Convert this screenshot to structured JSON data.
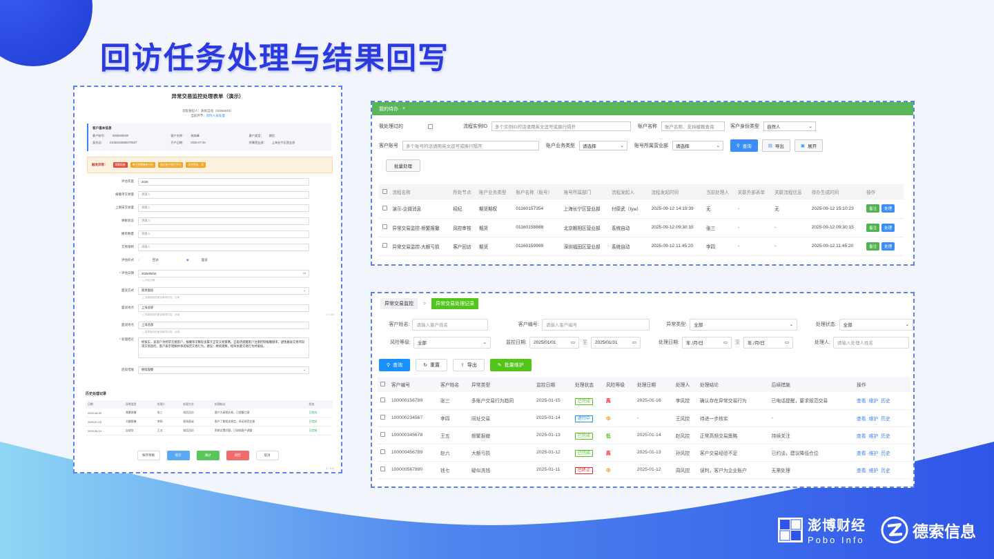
{
  "slide": {
    "title": "回访任务处理与结果回写",
    "colors": {
      "title": "#2a3ae0",
      "accent_blue": "#3b82f6",
      "green": "#52c41a",
      "wave": "#2f55e8"
    }
  },
  "form_panel": {
    "title": "异常交易监控处理表单（演示）",
    "meta_line1": "流程发起人：系统自动（20250915）",
    "meta_line2_prefix": "当前环节：",
    "meta_line2_link": "风险人员处理",
    "info_title": "客户基本信息",
    "info": [
      {
        "label": "客户账号：",
        "value": "0000000000"
      },
      {
        "label": "客户名称：",
        "value": "林奕峰"
      },
      {
        "label": "客户类型：",
        "value": "期货"
      },
      {
        "label": "身份证：",
        "value": "21060319550070527"
      },
      {
        "label": "开户日期：",
        "value": "2025-07-26"
      },
      {
        "label": "所属营业部：",
        "value": "上海长宁区营业部"
      }
    ],
    "alert_label": "触发异常：",
    "alert_tags": [
      {
        "text": "频繁报撤",
        "color": "#e84b3c"
      },
      {
        "text": "单日频繁撤单分析",
        "color": "#f5a623"
      },
      {
        "text": "指定账户隔日平仓",
        "color": "#f5a623"
      },
      {
        "text": "风险等级：高",
        "color": "#f5a623"
      }
    ],
    "fields": [
      {
        "label": "评估年度",
        "value": "2025",
        "filled": true
      },
      {
        "label": "报撤单交易量",
        "value": "请输入",
        "filled": false
      },
      {
        "label": "上期末交易量",
        "value": "请输入",
        "filled": false
      },
      {
        "label": "休眠状态",
        "value": "请输入",
        "filled": false
      },
      {
        "label": "撤单数量",
        "value": "请输入",
        "filled": false
      },
      {
        "label": "交易限制",
        "value": "请输入",
        "filled": false
      }
    ],
    "eval_method_label": "评估形式",
    "eval_methods": [
      "回访",
      "面谈"
    ],
    "eval_date_label": "* 评估日期",
    "eval_date": "2025/09/15",
    "eval_date_hint": "△ 评估日期",
    "interview_method_label": "面谈方式",
    "interview_method": "现场面谈",
    "interview_hint": "△ 选择面谈的面谈事项内容，必填",
    "interview_place_label": "面谈地点",
    "interview_place": "上海总部",
    "interview_place_hint": "△ 选择面谈的面谈事项内容，必填",
    "interview_place2_label": "面谈地点",
    "interview_place2": "上海总部",
    "interview_place2_hint": "△ 选择面谈的面谈事项内容，必填",
    "conclusion_label": "* 处理结论",
    "conclusion": "经核实，该客户为经常无规客户，报撤单次数较多属于正常交易策略。已电话提醒客户注意控制报撤频率，避免触发交易所异常交易监控。客户表示理解并承诺规范交易行为。建议：继续观察，指导关键交易行为并复核。",
    "result_label": "后续措施",
    "result_value": "继续观察",
    "page_no_1": "4 / 100",
    "page_no_2": "4 / 100",
    "history_title": "历史处理记录",
    "history_headers": [
      "日期",
      "异常类型",
      "处理人",
      "处理方式",
      "处理结论",
      "状态"
    ],
    "history_rows": [
      [
        "2025-06-20",
        "频繁报撤",
        "张三",
        "电话回访",
        "客户为高频交易，已提醒注意",
        "已完成"
      ],
      [
        "2025-07-15",
        "大额报撤",
        "李四",
        "现场面谈",
        "客户了解相关规定，承诺规范交易",
        "已完成"
      ],
      [
        "2025-06-10",
        "自成交",
        "王五",
        "电话回访",
        "系统设置问题，已协助客户调整",
        "已完成"
      ]
    ],
    "buttons": [
      {
        "text": "保存草稿",
        "bg": "#ffffff",
        "fg": "#555555"
      },
      {
        "text": "提交",
        "bg": "#5ba8f5",
        "fg": "#ffffff"
      },
      {
        "text": "通过",
        "bg": "#5cc45c",
        "fg": "#ffffff"
      },
      {
        "text": "驳回",
        "bg": "#f26b6b",
        "fg": "#ffffff"
      },
      {
        "text": "取消",
        "bg": "#ffffff",
        "fg": "#555555"
      }
    ]
  },
  "todo_panel": {
    "header": "我的待办",
    "header_close": "×",
    "q_processed": "我处理过的",
    "q_instance_label": "流程实例ID",
    "q_instance_ph": "多个实例ID的话请用英文逗号或换行隔开",
    "q_acct_name_label": "账户名称",
    "q_acct_name_ph": "账户名称、支持模糊查询",
    "q_identity_label": "客户身份类型",
    "q_identity_val": "自然人",
    "q_acct_no_label": "客户账号",
    "q_acct_no_ph": "多个账号的话请用英文逗号或换行隔开",
    "q_biz_type_label": "账户业务类型",
    "q_biz_type_val": "请选择",
    "q_dept_label": "账号所属营业部",
    "q_dept_val": "请选择",
    "btn_search": "查询",
    "btn_export": "导出",
    "btn_expand": "展开",
    "btn_batch": "批量处理",
    "headers": [
      "流程名称",
      "所处节点",
      "账户业务类型",
      "账户名称（账号）",
      "账号所属部门",
      "流程发起人",
      "流程发起时间",
      "当前处理人",
      "关联外部表单",
      "关联流程信息",
      "待办生成时间",
      "操作"
    ],
    "rows": [
      [
        "演示-企微消息",
        "经纪",
        "期货期权",
        "01160157354",
        "上海长宁区营业部",
        "付原武（fyw）",
        "2025-09-12 14:19:39",
        "无",
        "-",
        "无",
        "2025-09-12 15:10:23"
      ],
      [
        "异常交易监控-频繁报撤",
        "风控审核",
        "期货",
        "01160158888",
        "北京朝阳区营业部",
        "系统自动",
        "2025-09-12 09:30:15",
        "张三",
        "-",
        "-",
        "2025-09-12 09:30:15"
      ],
      [
        "异常交易监控-大额亏损",
        "客户回访",
        "期货",
        "01160159999",
        "深圳福田区营业部",
        "系统自动",
        "2025-09-12 11:45:20",
        "李四",
        "-",
        "-",
        "2025-09-12 11:45:20"
      ]
    ],
    "op_note": "备注",
    "op_handle": "处理"
  },
  "record_panel": {
    "crumb1": "异常交易监控",
    "crumb_sep": ">",
    "crumb2": "异常交易处理记录",
    "f_name_label": "客户姓名:",
    "f_name_ph": "请输入客户姓名",
    "f_code_label": "客户编号:",
    "f_code_ph": "请输入客户编号",
    "f_type_label": "异常类型:",
    "f_type_val": "全部",
    "f_status_label": "处理状态:",
    "f_status_val": "全部",
    "f_risk_label": "风险等级:",
    "f_risk_val": "全部",
    "f_mdate_label": "监控日期:",
    "f_mdate_from": "2025/01/01",
    "f_mdate_to": "2025/01/31",
    "f_range_sep": "至",
    "f_pdate_label": "处理日期:",
    "f_pdate_ph": "年 /月/日",
    "f_handler_label": "处理人:",
    "f_handler_ph": "请输入处理人姓名",
    "btn_search": "查询",
    "btn_reset": "重置",
    "btn_export": "导出",
    "btn_batch": "批量维护",
    "headers": [
      "客户编号",
      "客户姓名",
      "异常类型",
      "监控日期",
      "处理状态",
      "风险等级",
      "处理日期",
      "处理人",
      "处理结论",
      "后续措施",
      "操作"
    ],
    "rows": [
      {
        "code": "100000156789",
        "name": "张三",
        "type": "多账户交易行为趋同",
        "mdate": "2025-01-15",
        "status": "已完成",
        "status_color": "#52c41a",
        "risk": "高",
        "risk_color": "#f5222d",
        "pdate": "2025-01-16",
        "handler": "李风控",
        "conclusion": "确认存在异常交易行为",
        "measure": "已电话提醒，要求规范交易"
      },
      {
        "code": "100000234567",
        "name": "李四",
        "type": "同址交易",
        "mdate": "2025-01-14",
        "status": "进行中",
        "status_color": "#1890ff",
        "risk": "中",
        "risk_color": "#fa8c16",
        "pdate": "-",
        "handler": "王风控",
        "conclusion": "待进一步核实",
        "measure": "-"
      },
      {
        "code": "100000345678",
        "name": "王五",
        "type": "频繁报撤",
        "mdate": "2025-01-13",
        "status": "已完成",
        "status_color": "#52c41a",
        "risk": "低",
        "risk_color": "#52c41a",
        "pdate": "2025-01-14",
        "handler": "赵风控",
        "conclusion": "正常高频交易策略",
        "measure": "持续关注"
      },
      {
        "code": "100000456789",
        "name": "赵六",
        "type": "大额亏损",
        "mdate": "2025-01-12",
        "status": "已完成",
        "status_color": "#52c41a",
        "risk": "高",
        "risk_color": "#f5222d",
        "pdate": "2025-01-13",
        "handler": "孙风控",
        "conclusion": "客户交易经验不足",
        "measure": "已约谈，建议降低仓位"
      },
      {
        "code": "100000567890",
        "name": "钱七",
        "type": "疑似洗钱",
        "mdate": "2025-01-11",
        "status": "已终止",
        "status_color": "#f5222d",
        "risk": "中",
        "risk_color": "#fa8c16",
        "pdate": "2025-01-12",
        "handler": "周风控",
        "conclusion": "误判，客户为企业账户",
        "measure": "无需处理"
      }
    ],
    "op_view": "查看",
    "op_maintain": "维护",
    "op_history": "历史"
  },
  "logos": {
    "pobo_cn": "澎博财经",
    "pobo_en": "Pobo Info",
    "desu": "德索信息"
  }
}
